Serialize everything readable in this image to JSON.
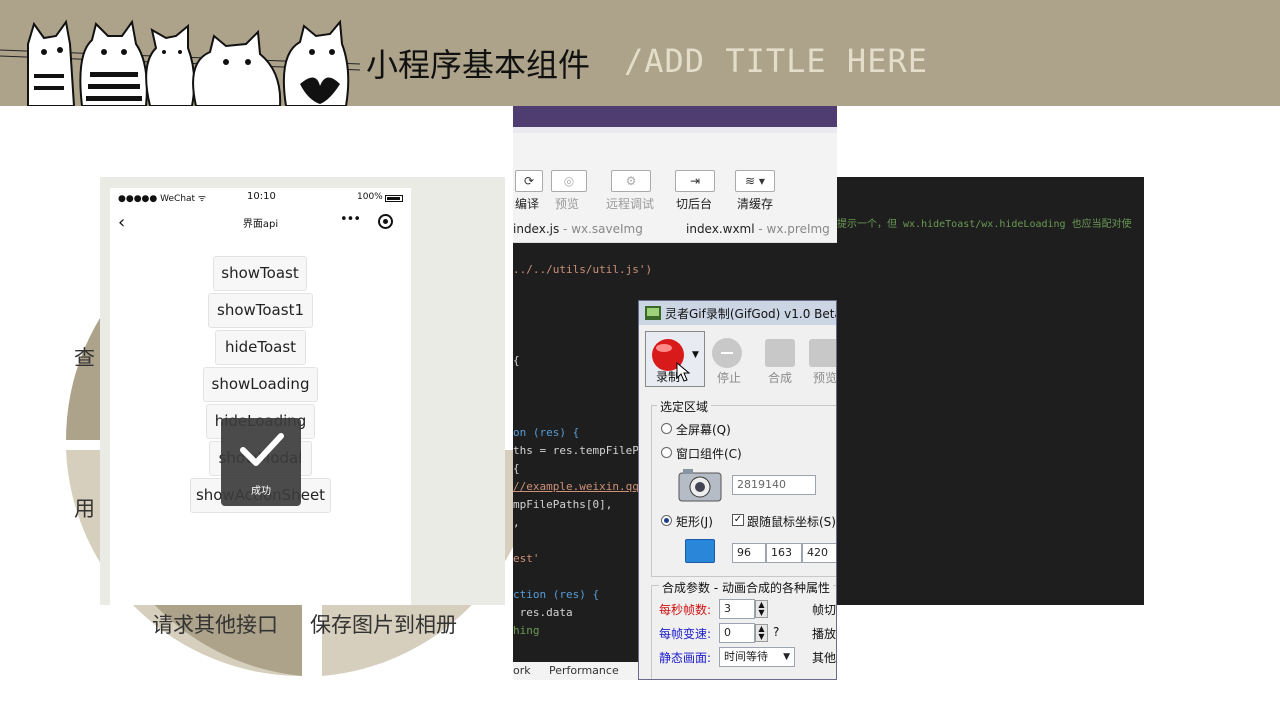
{
  "header": {
    "title_cn": "小程序基本组件",
    "title_en": "/ADD TITLE HERE"
  },
  "circle": {
    "labels": [
      "查",
      "用",
      "请求其他接口",
      "保存图片到相册"
    ]
  },
  "phone": {
    "status_left": "●●●●● WeChat ᯤ",
    "time": "10:10",
    "battery": "100%",
    "nav_back": "‹",
    "nav_title": "界面api",
    "nav_more": "•••",
    "buttons": [
      "showToast",
      "showToast1",
      "hideToast",
      "showLoading",
      "hideLoading",
      "showModal",
      "showActionSheet"
    ],
    "toast_text": "成功"
  },
  "devtools": {
    "toolbar": [
      {
        "label": "编译",
        "icon": "⟳"
      },
      {
        "label": "预览",
        "icon": "◎"
      },
      {
        "label": "远程调试",
        "icon": "⚙"
      },
      {
        "label": "切后台",
        "icon": "⇥"
      },
      {
        "label": "清缓存",
        "icon": "≋ ▾"
      }
    ],
    "tabs": [
      {
        "name": "index.js",
        "sub": " - wx.saveImg"
      },
      {
        "name": "index.wxml",
        "sub": " - wx.preImg"
      }
    ],
    "code_lines": [
      "../../utils/util.js')",
      "{",
      "on (res) {",
      "ths = res.tempFileP",
      "{",
      "//example.weixin.qq",
      "mpFilePaths[0],",
      ",",
      "est'",
      "ction (res) {",
      " res.data",
      "hing"
    ],
    "bottom_tabs": [
      "ork",
      "Performance"
    ]
  },
  "gif_tool": {
    "title": "灵者Gif录制(GifGod) v1.0 Beta",
    "record": "录制",
    "stop": "停止",
    "compose": "合成",
    "preview": "预览",
    "area_group": "选定区域",
    "fullscreen": "全屏幕(Q)",
    "window": "窗口组件(C)",
    "window_id": "2819140",
    "rect": "矩形(J)",
    "follow_mouse": "跟随鼠标坐标(S)",
    "rect_values": [
      "96",
      "163",
      "420"
    ],
    "params_group": "合成参数 - 动画合成的各种属性",
    "fps_label": "每秒帧数:",
    "fps": "3",
    "fps_right": "帧切",
    "speed_label": "每帧变速:",
    "speed": "0",
    "speed_q": "?",
    "speed_right": "播放",
    "static_label": "静态画面:",
    "static_value": "时间等待",
    "static_right": "其他"
  },
  "console": {
    "text": "提示一个，但 wx.hideToast/wx.hideLoading 也应当配对使"
  },
  "colors": {
    "header_bg": "#ada38a",
    "title_en": "#e4ddc9",
    "circle_dark": "#ada38a",
    "circle_light": "#d6cfbd"
  }
}
